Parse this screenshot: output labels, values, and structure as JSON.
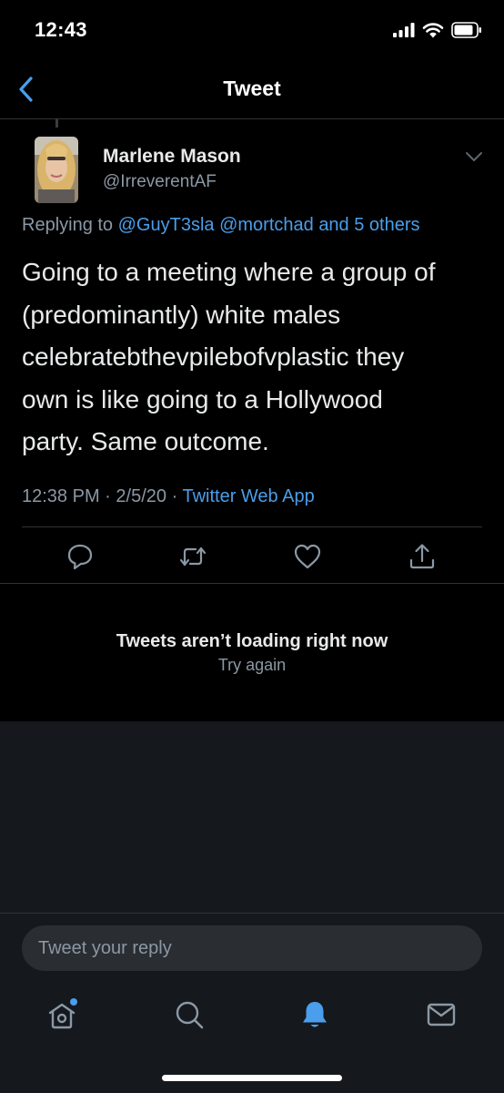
{
  "status_bar": {
    "time": "12:43"
  },
  "header": {
    "title": "Tweet"
  },
  "tweet": {
    "author_name": "Marlene Mason",
    "author_handle": "@IrreverentAF",
    "replying_prefix": "Replying to",
    "replying_mention1": "@GuyT3sla",
    "replying_mention2": "@mortchad",
    "replying_others": "and 5 others",
    "text_lines": [
      "Going to a meeting where a group of",
      "(predominantly) white males",
      "celebratebthevpilebofvplastic they",
      "own is like going to a Hollywood",
      "party. Same outcome."
    ],
    "time": "12:38 PM",
    "date": "2/5/20",
    "dot": "·",
    "source": "Twitter Web App"
  },
  "error": {
    "title": "Tweets aren’t loading right now",
    "retry": "Try again"
  },
  "reply": {
    "placeholder": "Tweet your reply"
  },
  "icons": {
    "back": "chevron-left-icon",
    "caret": "chevron-down-icon",
    "reply": "comment-icon",
    "retweet": "retweet-icon",
    "like": "heart-icon",
    "share": "share-icon",
    "home": "home-icon",
    "search": "search-icon",
    "notifications": "bell-icon",
    "messages": "mail-icon"
  },
  "colors": {
    "accent": "#4a9eeb",
    "background": "#000000",
    "muted": "#8b98a5",
    "panel": "#15181c"
  }
}
